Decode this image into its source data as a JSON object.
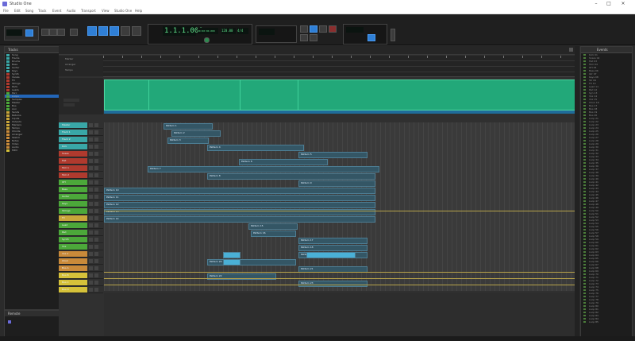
{
  "app": {
    "title": "Studio One"
  },
  "menu": [
    "File",
    "Edit",
    "Song",
    "Track",
    "Event",
    "Audio",
    "Transport",
    "View",
    "Studio One",
    "Help"
  ],
  "transport": {
    "time_main": "1.1.1.000",
    "time_small": "00:00:00.000",
    "tempo": "120.00",
    "signature": "4/4"
  },
  "left_panel": {
    "header": "Tracks",
    "footer": "Remote"
  },
  "right_panel": {
    "header": "Events"
  },
  "ruler_labels": [
    "Marker",
    "Arranger",
    "Tempo"
  ],
  "colors": {
    "accent_blue": "#2f7fd6",
    "lcd_green": "#5fe28a",
    "audio_green": "#22a879",
    "clip_blue": "#345665",
    "gold": "#b7a24a"
  },
  "tracks": [
    {
      "name": "Master",
      "color": "#39a7a7"
    },
    {
      "name": "Track 1",
      "color": "#39a7a7"
    },
    {
      "name": "Track 2",
      "color": "#39a7a7"
    },
    {
      "name": "Kick",
      "color": "#39a7a7"
    },
    {
      "name": "Snare",
      "color": "#b03a2e"
    },
    {
      "name": "Hat",
      "color": "#b03a2e"
    },
    {
      "name": "Tom 1",
      "color": "#b03a2e"
    },
    {
      "name": "Tom 2",
      "color": "#b03a2e"
    },
    {
      "name": "OH",
      "color": "#4ca83a"
    },
    {
      "name": "Bass",
      "color": "#4ca83a"
    },
    {
      "name": "Guitar",
      "color": "#4ca83a"
    },
    {
      "name": "Keys",
      "color": "#4ca83a"
    },
    {
      "name": "Strings",
      "color": "#4ca83a"
    },
    {
      "name": "FX",
      "color": "#c9a63a"
    },
    {
      "name": "Lead",
      "color": "#4ca83a"
    },
    {
      "name": "Pad",
      "color": "#4ca83a"
    },
    {
      "name": "Synth",
      "color": "#4ca83a"
    },
    {
      "name": "Vox",
      "color": "#4ca83a"
    },
    {
      "name": "Vox 2",
      "color": "#c98a3a"
    },
    {
      "name": "Choir",
      "color": "#c98a3a"
    },
    {
      "name": "Bus A",
      "color": "#c98a3a"
    },
    {
      "name": "Bus B",
      "color": "#d6c23a"
    },
    {
      "name": "Bus C",
      "color": "#d6c23a"
    },
    {
      "name": "Bus D",
      "color": "#d6c23a"
    }
  ],
  "browser_items": [
    "Song",
    "Tracks",
    "Drums",
    "Bass",
    "Guitar",
    "Keys",
    "Synth",
    "Vocals",
    "FX",
    "Strings",
    "Pads",
    "Leads",
    "Perc",
    "Loops",
    "Samples",
    "Master",
    "Bus",
    "Aux",
    "Sends",
    "Returns",
    "Inputs",
    "Outputs",
    "Markers",
    "Tempo",
    "Chords",
    "Arranger",
    "Sketch",
    "Notes",
    "Video",
    "Audio",
    "MIDI"
  ],
  "event_items": [
    "Kick 01",
    "Snare 02",
    "Hat 03",
    "Tom 04",
    "OH 05",
    "Bass 06",
    "Gtr 07",
    "Keys 08",
    "Str 09",
    "FX 10",
    "Lead 11",
    "Pad 12",
    "Syn 13",
    "Vox 14",
    "Vox 15",
    "Choir 16",
    "Bus 17",
    "Bus 18",
    "Bus 19",
    "Bus 20",
    "Loop 21",
    "Loop 22",
    "Loop 23",
    "Loop 24",
    "Loop 25",
    "Loop 26",
    "Loop 27",
    "Loop 28",
    "Loop 29",
    "Loop 30",
    "Loop 31",
    "Loop 32",
    "Loop 33",
    "Loop 34",
    "Loop 35",
    "Loop 36",
    "Loop 37",
    "Loop 38",
    "Loop 39",
    "Loop 40",
    "Loop 41",
    "Loop 42",
    "Loop 43",
    "Loop 44",
    "Loop 45",
    "Loop 46",
    "Loop 47",
    "Loop 48",
    "Loop 49",
    "Loop 50",
    "Loop 51",
    "Loop 52",
    "Loop 53",
    "Loop 54",
    "Loop 55",
    "Loop 56",
    "Loop 57",
    "Loop 58",
    "Loop 59",
    "Loop 60",
    "Loop 61",
    "Loop 62",
    "Loop 63",
    "Loop 64",
    "Loop 65",
    "Loop 66",
    "Loop 67",
    "Loop 68",
    "Loop 69",
    "Loop 70",
    "Loop 71",
    "Loop 72",
    "Loop 73",
    "Loop 74",
    "Loop 75",
    "Loop 76",
    "Loop 77",
    "Loop 78",
    "Loop 79",
    "Loop 80",
    "Loop 81",
    "Loop 82",
    "Loop 83",
    "Loop 84",
    "Loop 85"
  ],
  "clips": [
    {
      "label": "Pattern 1",
      "row": 0
    },
    {
      "label": "Pattern 2",
      "row": 1
    },
    {
      "label": "Pattern 3",
      "row": 2
    },
    {
      "label": "Pattern 4",
      "row": 3
    },
    {
      "label": "Pattern 5",
      "row": 4
    },
    {
      "label": "Pattern 6",
      "row": 5
    },
    {
      "label": "Pattern 7",
      "row": 6
    },
    {
      "label": "Pattern 8",
      "row": 7
    },
    {
      "label": "Pattern 9",
      "row": 8
    },
    {
      "label": "Pattern 10",
      "row": 9
    },
    {
      "label": "Pattern 11",
      "row": 10
    },
    {
      "label": "Pattern 12",
      "row": 11
    },
    {
      "label": "Pattern 13",
      "row": 12
    },
    {
      "label": "Pattern 14",
      "row": 13
    },
    {
      "label": "Pattern 15",
      "row": 14
    },
    {
      "label": "Pattern 16",
      "row": 15
    },
    {
      "label": "Pattern 17",
      "row": 16
    },
    {
      "label": "Pattern 18",
      "row": 17
    },
    {
      "label": "Pattern 19",
      "row": 18
    },
    {
      "label": "Pattern 20",
      "row": 19
    },
    {
      "label": "Pattern 21",
      "row": 20
    },
    {
      "label": "Pattern 22",
      "row": 21
    },
    {
      "label": "Pattern 23",
      "row": 22
    }
  ]
}
